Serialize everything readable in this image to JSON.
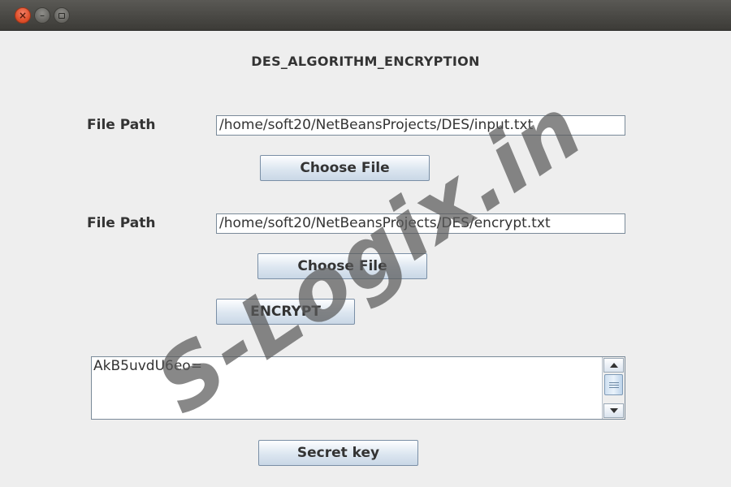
{
  "window": {
    "controls": {
      "close_icon": "close-icon",
      "minimize_icon": "minimize-icon",
      "maximize_icon": "maximize-icon"
    }
  },
  "heading": "DES_ALGORITHM_ENCRYPTION",
  "input_file": {
    "label": "File Path",
    "value": "/home/soft20/NetBeansProjects/DES/input.txt",
    "button": "Choose File"
  },
  "output_file": {
    "label": "File Path",
    "value": "/home/soft20/NetBeansProjects/DES/encrypt.txt",
    "button": "Choose File"
  },
  "encrypt_button": "ENCRYPT",
  "output_text": "AkB5uvdU6eo=",
  "secret_key_button": "Secret key",
  "watermark": "S-Logix.in",
  "colors": {
    "titlebar": "#3c3b37",
    "close_button": "#e0502b",
    "window_background": "#eeeeee",
    "button_gradient_end": "#c9d7e6"
  }
}
